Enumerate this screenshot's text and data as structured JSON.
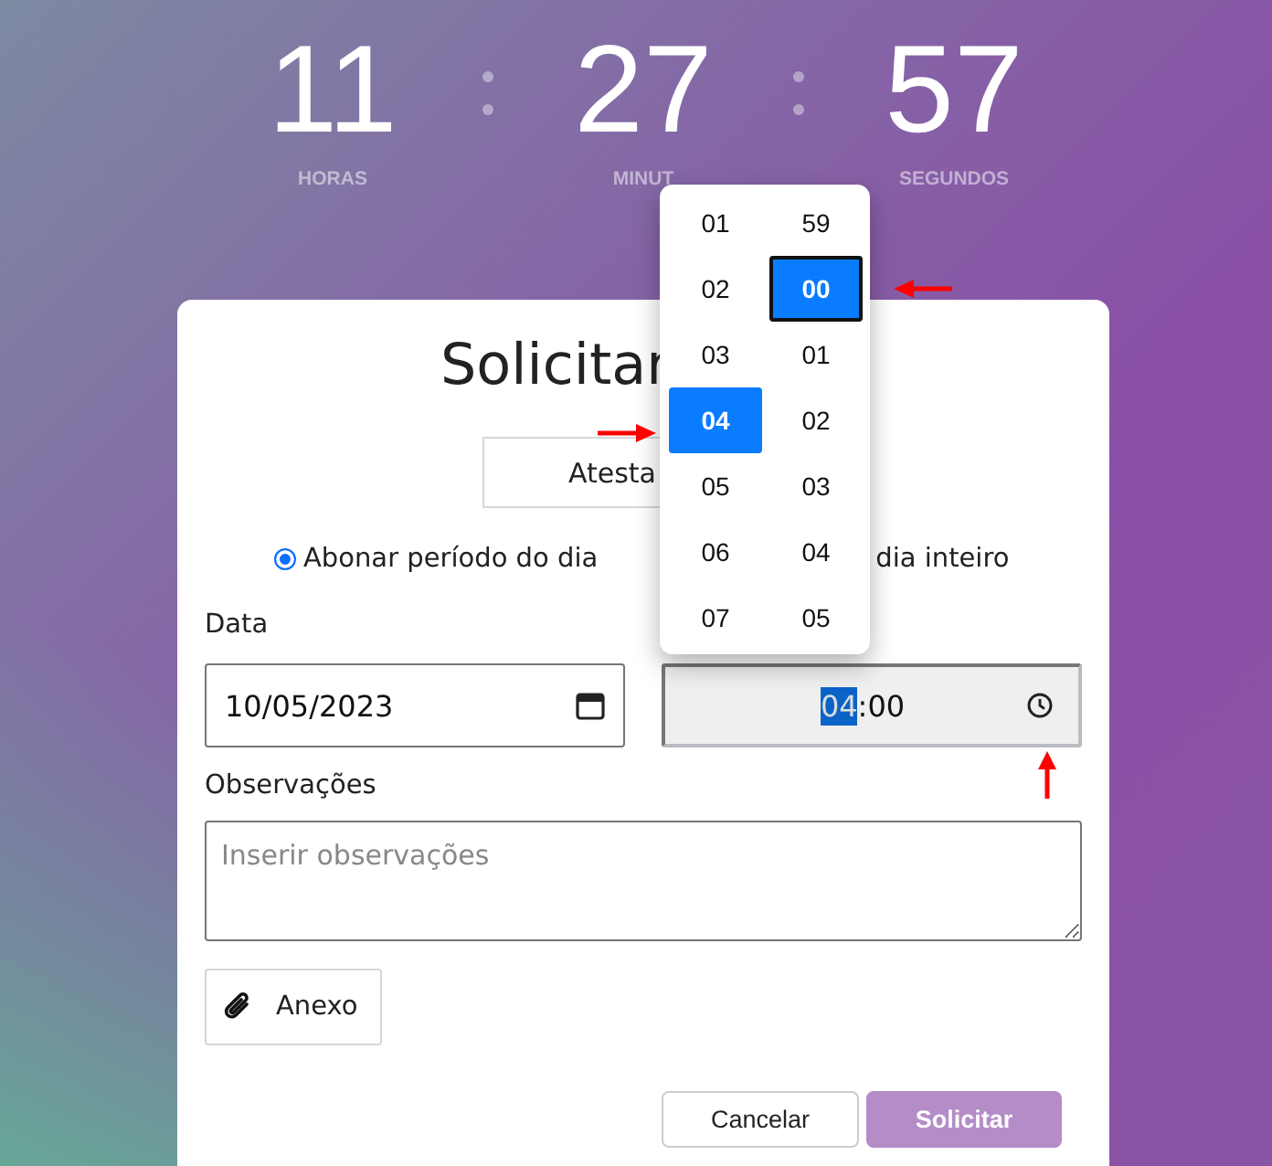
{
  "countdown": [
    {
      "value": "11",
      "label": "HORAS"
    },
    {
      "value": "27",
      "label": "MINUT"
    },
    {
      "value": "57",
      "label": "SEGUNDOS"
    }
  ],
  "dialog": {
    "title": "Solicitar",
    "type_button": "Atesta",
    "options": [
      {
        "kind": "radio",
        "label": "Abonar período do dia",
        "selected": true
      },
      {
        "kind": "text",
        "label": "dia inteiro"
      }
    ],
    "date": {
      "label": "Data",
      "value": "10/05/2023"
    },
    "time": {
      "hours": "04",
      "rest": ":00",
      "hours_highlighted": true
    },
    "notes": {
      "label": "Observações",
      "placeholder": "Inserir observações"
    },
    "attach_button": "Anexo",
    "buttons": [
      {
        "label": "Cancelar",
        "kind": "secondary"
      },
      {
        "label": "Solicitar",
        "kind": "primary"
      }
    ]
  },
  "time_picker": {
    "hours": [
      {
        "text": "01",
        "selected": false
      },
      {
        "text": "02",
        "selected": false
      },
      {
        "text": "03",
        "selected": false
      },
      {
        "text": "04",
        "selected": true
      },
      {
        "text": "05",
        "selected": false
      },
      {
        "text": "06",
        "selected": false
      },
      {
        "text": "07",
        "selected": false
      }
    ],
    "minutes": [
      {
        "text": "59",
        "selected": false
      },
      {
        "text": "00",
        "selected": true
      },
      {
        "text": "01",
        "selected": false
      },
      {
        "text": "02",
        "selected": false
      },
      {
        "text": "03",
        "selected": false
      },
      {
        "text": "04",
        "selected": false
      },
      {
        "text": "05",
        "selected": false
      }
    ]
  }
}
